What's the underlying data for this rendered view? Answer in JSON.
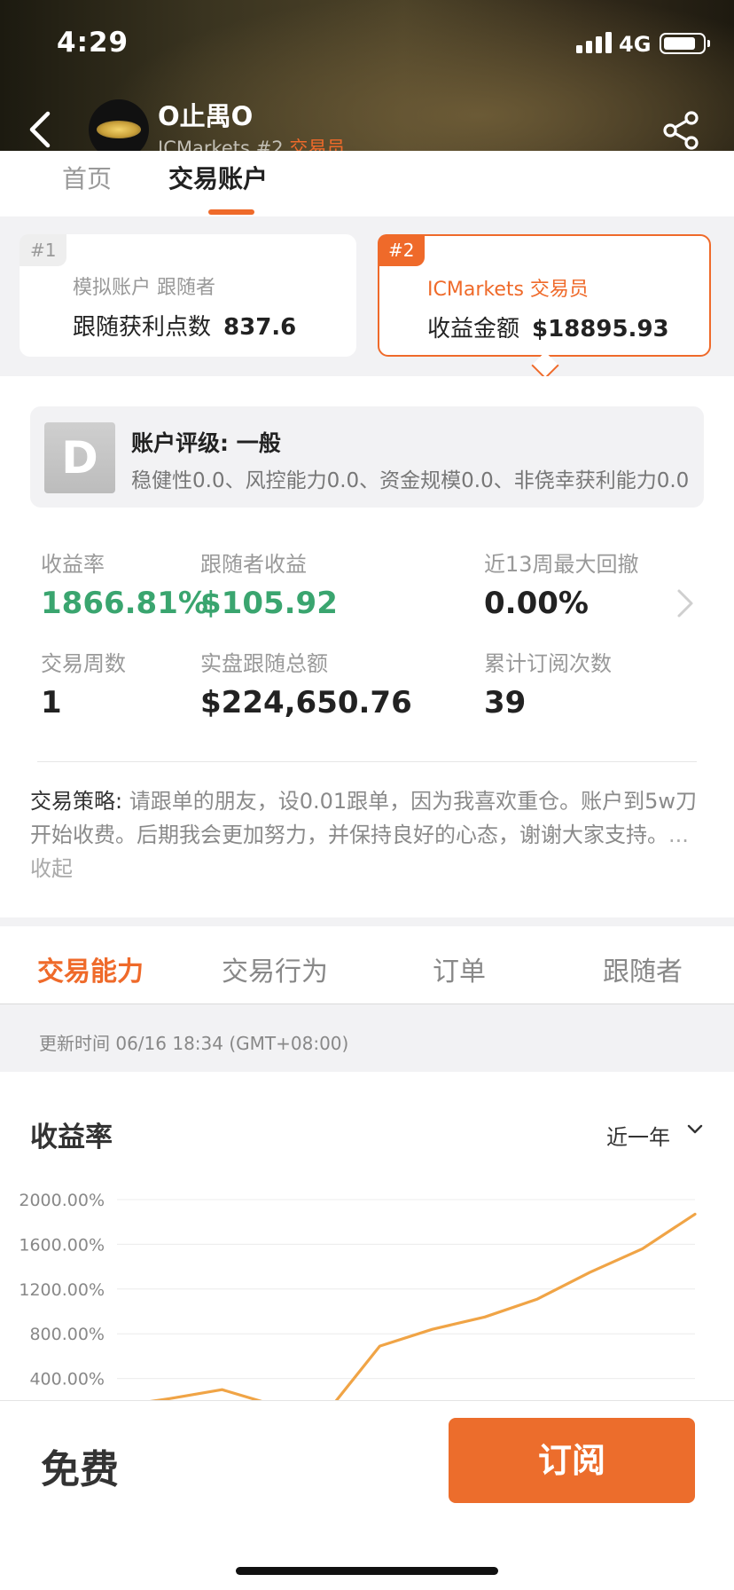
{
  "status_bar": {
    "time": "4:29",
    "network": "4G",
    "signal_icon": "signal-bars-icon",
    "battery_icon": "battery-icon"
  },
  "header": {
    "back_icon": "chevron-left-icon",
    "username": "O止禺O",
    "account_broker": "ICMarkets",
    "account_no": "#2",
    "role": "交易员",
    "share_icon": "share-icon"
  },
  "top_tabs": [
    {
      "label": "首页",
      "active": false
    },
    {
      "label": "交易账户",
      "active": true
    }
  ],
  "accounts": [
    {
      "badge": "#1",
      "line1": "模拟账户  跟随者",
      "metric_label": "跟随获利点数",
      "metric_value": "837.6",
      "selected": false
    },
    {
      "badge": "#2",
      "line1": "ICMarkets  交易员",
      "metric_label": "收益金额",
      "metric_value": "$18895.93",
      "selected": true
    }
  ],
  "rating": {
    "grade": "D",
    "title": "账户评级: 一般",
    "detail": "稳健性0.0、风控能力0.0、资金规模0.0、非侥幸获利能力0.0"
  },
  "stats": [
    {
      "label": "收益率",
      "value": "1866.81%",
      "highlight": true
    },
    {
      "label": "跟随者收益",
      "value": "$105.92",
      "highlight": true
    },
    {
      "label": "近13周最大回撤",
      "value": "0.00%",
      "highlight": false
    },
    {
      "label": "交易周数",
      "value": "1",
      "highlight": false
    },
    {
      "label": "实盘跟随总额",
      "value": "$224,650.76",
      "highlight": false
    },
    {
      "label": "累计订阅次数",
      "value": "39",
      "highlight": false
    }
  ],
  "strategy": {
    "label": "交易策略:",
    "text": " 请跟单的朋友，设0.01跟单，因为我喜欢重仓。账户到5w刀开始收费。后期我会更加努力，并保持良好的心态，谢谢大家支持。",
    "more": "...收起"
  },
  "section_tabs": [
    {
      "label": "交易能力",
      "active": true
    },
    {
      "label": "交易行为",
      "active": false
    },
    {
      "label": "订单",
      "active": false
    },
    {
      "label": "跟随者",
      "active": false
    }
  ],
  "update_time": "更新时间 06/16 18:34 (GMT+08:00)",
  "chart_section": {
    "title": "收益率",
    "period": "近一年",
    "period_icon": "chevron-down-icon"
  },
  "chart_data": {
    "type": "line",
    "title": "收益率",
    "xlabel": "",
    "ylabel": "",
    "y_ticks": [
      "2000.00%",
      "1600.00%",
      "1200.00%",
      "800.00%",
      "400.00%"
    ],
    "ylim": [
      0,
      2000
    ],
    "x": [
      0,
      1,
      2,
      3,
      4,
      5,
      6,
      7,
      8,
      9,
      10,
      11
    ],
    "series": [
      {
        "values": [
          150,
          220,
          300,
          160,
          100,
          690,
          840,
          950,
          1110,
          1350,
          1560,
          1870
        ],
        "color": "#f0a446"
      }
    ],
    "grid": true,
    "legend": "none"
  },
  "footer": {
    "price_label": "免费",
    "subscribe_label": "订阅"
  },
  "colors": {
    "accent": "#ef6a2a",
    "positive": "#3aa56f",
    "chart_line": "#f0a446"
  }
}
